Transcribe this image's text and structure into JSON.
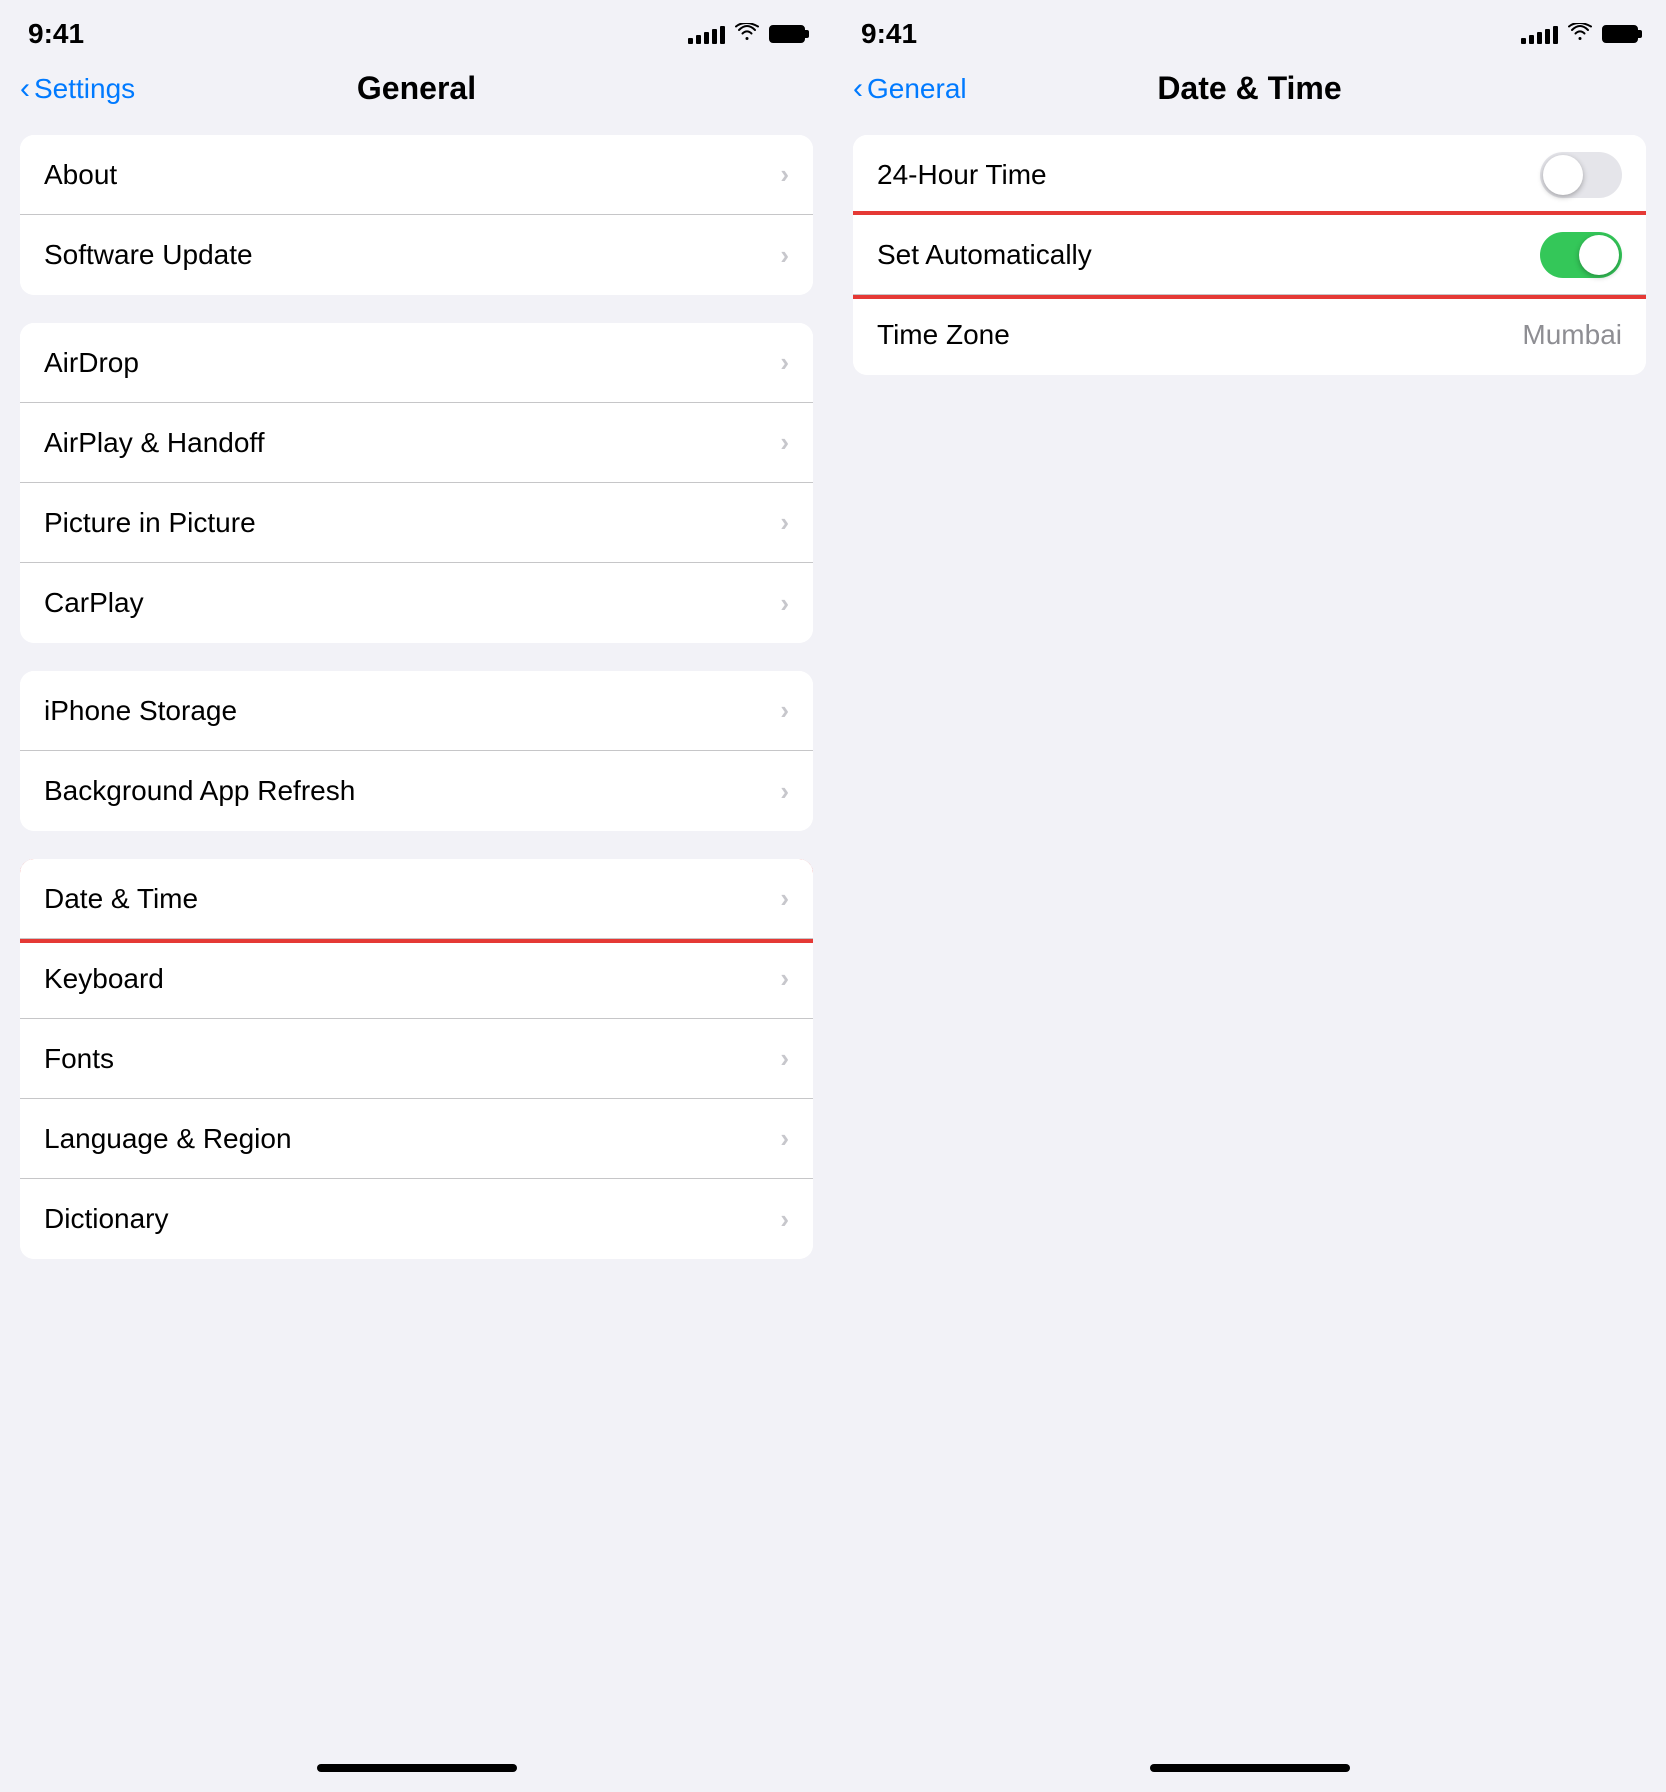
{
  "left_panel": {
    "status": {
      "time": "9:41",
      "signal_bars": [
        6,
        9,
        12,
        15,
        18
      ],
      "wifi": "wifi",
      "battery": "battery"
    },
    "nav": {
      "back_label": "Settings",
      "title": "General"
    },
    "groups": [
      {
        "id": "group1",
        "rows": [
          {
            "id": "about",
            "label": "About",
            "value": "",
            "highlighted": false
          },
          {
            "id": "software-update",
            "label": "Software Update",
            "value": "",
            "highlighted": false
          }
        ]
      },
      {
        "id": "group2",
        "rows": [
          {
            "id": "airdrop",
            "label": "AirDrop",
            "value": "",
            "highlighted": false
          },
          {
            "id": "airplay-handoff",
            "label": "AirPlay & Handoff",
            "value": "",
            "highlighted": false
          },
          {
            "id": "picture-in-picture",
            "label": "Picture in Picture",
            "value": "",
            "highlighted": false
          },
          {
            "id": "carplay",
            "label": "CarPlay",
            "value": "",
            "highlighted": false
          }
        ]
      },
      {
        "id": "group3",
        "rows": [
          {
            "id": "iphone-storage",
            "label": "iPhone Storage",
            "value": "",
            "highlighted": false
          },
          {
            "id": "background-app-refresh",
            "label": "Background App Refresh",
            "value": "",
            "highlighted": false
          }
        ]
      },
      {
        "id": "group4",
        "rows": [
          {
            "id": "date-time",
            "label": "Date & Time",
            "value": "",
            "highlighted": true
          },
          {
            "id": "keyboard",
            "label": "Keyboard",
            "value": "",
            "highlighted": false
          },
          {
            "id": "fonts",
            "label": "Fonts",
            "value": "",
            "highlighted": false
          },
          {
            "id": "language-region",
            "label": "Language & Region",
            "value": "",
            "highlighted": false
          },
          {
            "id": "dictionary",
            "label": "Dictionary",
            "value": "",
            "highlighted": false
          }
        ]
      }
    ]
  },
  "right_panel": {
    "status": {
      "time": "9:41"
    },
    "nav": {
      "back_label": "General",
      "title": "Date & Time"
    },
    "groups": [
      {
        "id": "dt-group1",
        "rows": [
          {
            "id": "24-hour-time",
            "label": "24-Hour Time",
            "type": "toggle",
            "toggle_state": "off",
            "highlighted": false
          },
          {
            "id": "set-automatically",
            "label": "Set Automatically",
            "type": "toggle",
            "toggle_state": "on",
            "highlighted": true
          },
          {
            "id": "time-zone",
            "label": "Time Zone",
            "value": "Mumbai",
            "type": "value",
            "highlighted": false
          }
        ]
      }
    ]
  }
}
